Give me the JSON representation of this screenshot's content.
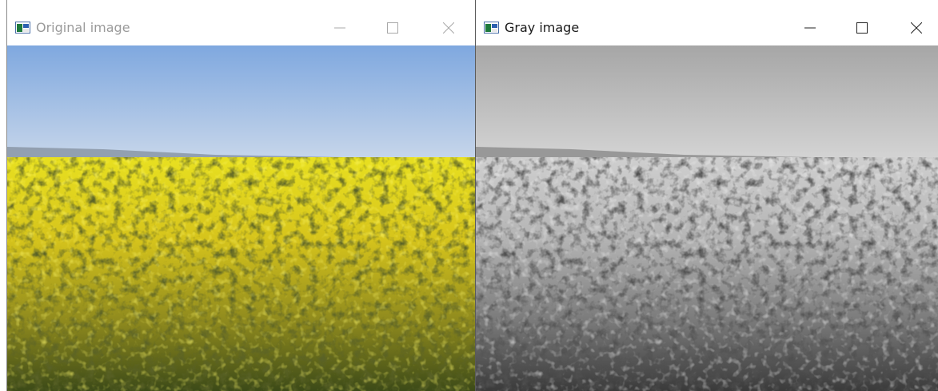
{
  "windows": [
    {
      "title": "Original image",
      "active": false,
      "icon": "opencv-window-icon",
      "controls": [
        "minimize-icon",
        "maximize-icon",
        "close-icon"
      ],
      "image": {
        "content": "rapeseed-field-color",
        "colors": {
          "sky_top": "#7fa8df",
          "sky_bottom": "#c7d6ea",
          "field_top": "#e8e020",
          "field_bottom": "#3c4a18"
        }
      }
    },
    {
      "title": "Gray image",
      "active": true,
      "icon": "opencv-window-icon",
      "controls": [
        "minimize-icon",
        "maximize-icon",
        "close-icon"
      ],
      "image": {
        "content": "rapeseed-field-grayscale",
        "colors": {
          "sky_top": "#a6a6a6",
          "sky_bottom": "#d4d4d4",
          "field_top": "#cfcfcf",
          "field_bottom": "#3a3a3a"
        }
      }
    }
  ]
}
